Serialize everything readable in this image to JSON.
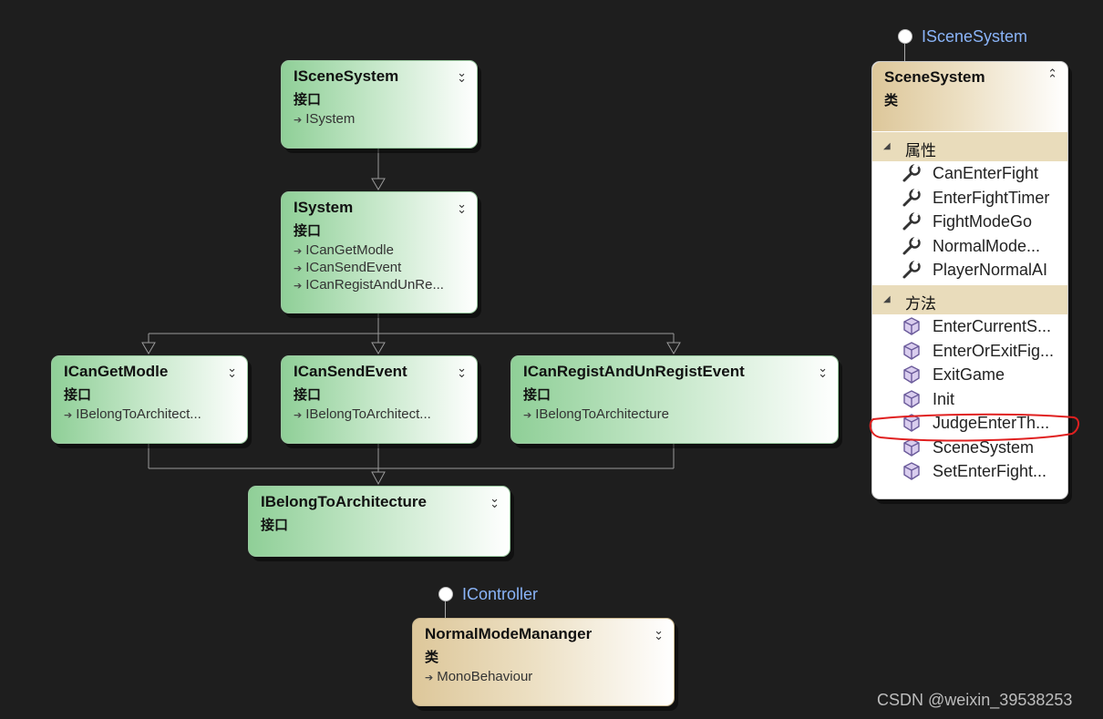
{
  "kind_interface": "接口",
  "kind_class": "类",
  "boxes": {
    "iscenesystem": {
      "title": "ISceneSystem",
      "inherits": [
        "ISystem"
      ]
    },
    "isystem": {
      "title": "ISystem",
      "inherits": [
        "ICanGetModle",
        "ICanSendEvent",
        "ICanRegistAndUnRe..."
      ]
    },
    "icangetmodle": {
      "title": "ICanGetModle",
      "inherits": [
        "IBelongToArchitect..."
      ]
    },
    "icansendevent": {
      "title": "ICanSendEvent",
      "inherits": [
        "IBelongToArchitect..."
      ]
    },
    "icanregist": {
      "title": "ICanRegistAndUnRegistEvent",
      "inherits": [
        "IBelongToArchitecture"
      ]
    },
    "ibelong": {
      "title": "IBelongToArchitecture",
      "inherits": []
    },
    "normalmode": {
      "title": "NormalModeMananger",
      "lollipop": "IController",
      "inherits": [
        "MonoBehaviour"
      ]
    }
  },
  "scene_system": {
    "lollipop": "ISceneSystem",
    "title": "SceneSystem",
    "properties_label": "属性",
    "properties": [
      "CanEnterFight",
      "EnterFightTimer",
      "FightModeGo",
      "NormalMode...",
      "PlayerNormalAI"
    ],
    "methods_label": "方法",
    "methods": [
      "EnterCurrentS...",
      "EnterOrExitFig...",
      "ExitGame",
      "Init",
      "JudgeEnterTh...",
      "SceneSystem",
      "SetEnterFight..."
    ]
  },
  "watermark": "CSDN @weixin_39538253",
  "colors": {
    "background": "#1e1e1e",
    "interface_accent": "#8fcf97",
    "class_accent": "#ddc79a",
    "highlight": "#e02020",
    "lollipop_label": "#8ab4f8"
  }
}
